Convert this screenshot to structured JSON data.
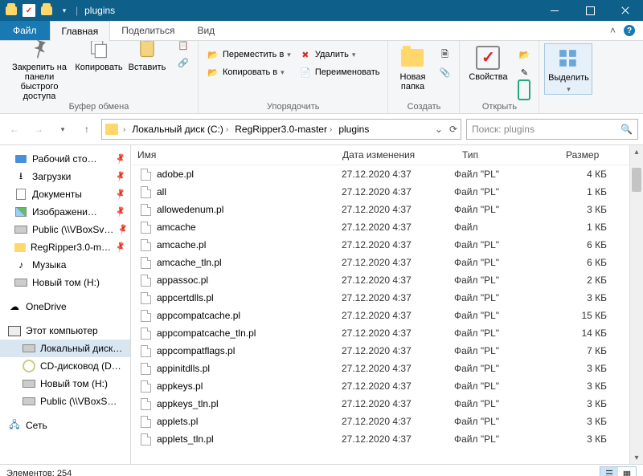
{
  "titlebar": {
    "title": "plugins"
  },
  "tabs": {
    "file": "Файл",
    "items": [
      "Главная",
      "Поделиться",
      "Вид"
    ],
    "active_index": 0
  },
  "ribbon": {
    "clipboard": {
      "label": "Буфер обмена",
      "pin": "Закрепить на панели быстрого доступа",
      "copy": "Копировать",
      "paste": "Вставить"
    },
    "organize": {
      "label": "Упорядочить",
      "move_to": "Переместить в",
      "copy_to": "Копировать в",
      "delete": "Удалить",
      "rename": "Переименовать"
    },
    "create": {
      "label": "Создать",
      "new_folder": "Новая папка"
    },
    "open": {
      "label": "Открыть",
      "properties": "Свойства"
    },
    "select": {
      "label": "",
      "select_all": "Выделить"
    }
  },
  "nav": {
    "breadcrumb": [
      "Локальный диск (C:)",
      "RegRipper3.0-master",
      "plugins"
    ],
    "search_placeholder": "Поиск: plugins"
  },
  "sidebar": {
    "quick": [
      {
        "label": "Рабочий сто…",
        "icon": "desktop",
        "pinned": true
      },
      {
        "label": "Загрузки",
        "icon": "down",
        "pinned": true
      },
      {
        "label": "Документы",
        "icon": "doc",
        "pinned": true
      },
      {
        "label": "Изображени…",
        "icon": "img",
        "pinned": true
      },
      {
        "label": "Public (\\\\VBoxSv…",
        "icon": "drive",
        "pinned": true
      },
      {
        "label": "RegRipper3.0-m…",
        "icon": "folder",
        "pinned": true
      },
      {
        "label": "Музыка",
        "icon": "music",
        "pinned": false
      },
      {
        "label": "Новый том (H:)",
        "icon": "drive",
        "pinned": false
      }
    ],
    "onedrive": {
      "label": "OneDrive",
      "icon": "cloud"
    },
    "thispc": {
      "label": "Этот компьютер",
      "icon": "pc"
    },
    "drives": [
      {
        "label": "Локальный диск…",
        "icon": "drive",
        "selected": true
      },
      {
        "label": "CD-дисковод (D…",
        "icon": "cd"
      },
      {
        "label": "Новый том (H:)",
        "icon": "drive"
      },
      {
        "label": "Public (\\\\VBoxS…",
        "icon": "drive"
      }
    ],
    "network": {
      "label": "Сеть",
      "icon": "net"
    }
  },
  "columns": {
    "name": "Имя",
    "date": "Дата изменения",
    "type": "Тип",
    "size": "Размер"
  },
  "files": [
    {
      "name": "adobe.pl",
      "date": "27.12.2020 4:37",
      "type": "Файл \"PL\"",
      "size": "4 КБ"
    },
    {
      "name": "all",
      "date": "27.12.2020 4:37",
      "type": "Файл \"PL\"",
      "size": "1 КБ"
    },
    {
      "name": "allowedenum.pl",
      "date": "27.12.2020 4:37",
      "type": "Файл \"PL\"",
      "size": "3 КБ"
    },
    {
      "name": "amcache",
      "date": "27.12.2020 4:37",
      "type": "Файл",
      "size": "1 КБ"
    },
    {
      "name": "amcache.pl",
      "date": "27.12.2020 4:37",
      "type": "Файл \"PL\"",
      "size": "6 КБ"
    },
    {
      "name": "amcache_tln.pl",
      "date": "27.12.2020 4:37",
      "type": "Файл \"PL\"",
      "size": "6 КБ"
    },
    {
      "name": "appassoc.pl",
      "date": "27.12.2020 4:37",
      "type": "Файл \"PL\"",
      "size": "2 КБ"
    },
    {
      "name": "appcertdlls.pl",
      "date": "27.12.2020 4:37",
      "type": "Файл \"PL\"",
      "size": "3 КБ"
    },
    {
      "name": "appcompatcache.pl",
      "date": "27.12.2020 4:37",
      "type": "Файл \"PL\"",
      "size": "15 КБ"
    },
    {
      "name": "appcompatcache_tln.pl",
      "date": "27.12.2020 4:37",
      "type": "Файл \"PL\"",
      "size": "14 КБ"
    },
    {
      "name": "appcompatflags.pl",
      "date": "27.12.2020 4:37",
      "type": "Файл \"PL\"",
      "size": "7 КБ"
    },
    {
      "name": "appinitdlls.pl",
      "date": "27.12.2020 4:37",
      "type": "Файл \"PL\"",
      "size": "3 КБ"
    },
    {
      "name": "appkeys.pl",
      "date": "27.12.2020 4:37",
      "type": "Файл \"PL\"",
      "size": "3 КБ"
    },
    {
      "name": "appkeys_tln.pl",
      "date": "27.12.2020 4:37",
      "type": "Файл \"PL\"",
      "size": "3 КБ"
    },
    {
      "name": "applets.pl",
      "date": "27.12.2020 4:37",
      "type": "Файл \"PL\"",
      "size": "3 КБ"
    },
    {
      "name": "applets_tln.pl",
      "date": "27.12.2020 4:37",
      "type": "Файл \"PL\"",
      "size": "3 КБ"
    }
  ],
  "status": {
    "items_label": "Элементов:",
    "count": "254"
  }
}
